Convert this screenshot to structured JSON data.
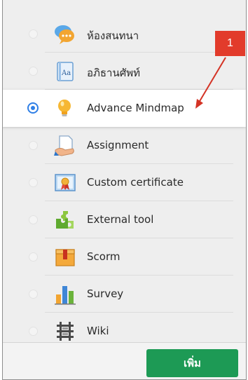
{
  "activities": [
    {
      "label": "ห้องสนทนา",
      "icon": "chat-icon",
      "selected": false
    },
    {
      "label": "อภิธานศัพท์",
      "icon": "glossary-icon",
      "selected": false
    },
    {
      "label": "Advance Mindmap",
      "icon": "lightbulb-icon",
      "selected": true
    },
    {
      "label": "Assignment",
      "icon": "assignment-icon",
      "selected": false
    },
    {
      "label": "Custom certificate",
      "icon": "certificate-icon",
      "selected": false
    },
    {
      "label": "External tool",
      "icon": "puzzle-icon",
      "selected": false
    },
    {
      "label": "Scorm",
      "icon": "scorm-package-icon",
      "selected": false
    },
    {
      "label": "Survey",
      "icon": "survey-chart-icon",
      "selected": false
    },
    {
      "label": "Wiki",
      "icon": "wiki-icon",
      "selected": false
    }
  ],
  "footer": {
    "add_label": "เพิ่ม"
  },
  "annotation": {
    "number": "1"
  },
  "colors": {
    "accent": "#2f7fe6",
    "button": "#1d9a55",
    "annotation": "#e23b2b"
  }
}
